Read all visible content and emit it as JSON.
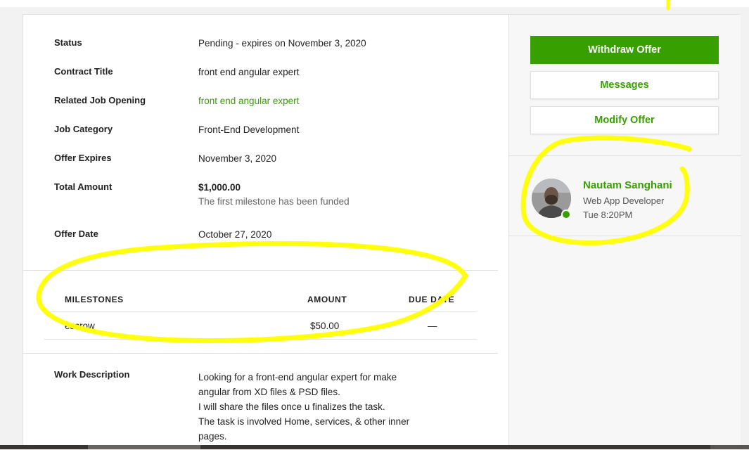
{
  "details": [
    {
      "label": "Status",
      "value": "Pending - expires on November 3, 2020"
    },
    {
      "label": "Contract Title",
      "value": "front end angular expert"
    },
    {
      "label": "Related Job Opening",
      "value": "front end angular expert"
    },
    {
      "label": "Job Category",
      "value": "Front-End Development"
    },
    {
      "label": "Offer Expires",
      "value": "November 3, 2020"
    },
    {
      "label": "Total Amount",
      "value": "$1,000.00",
      "note": "The first milestone has been funded"
    },
    {
      "label": "Offer Date",
      "value": "October 27, 2020"
    }
  ],
  "milestones": {
    "headers": {
      "name": "MILESTONES",
      "amount": "AMOUNT",
      "due": "DUE DATE"
    },
    "rows": [
      {
        "name": "escrow",
        "amount": "$50.00",
        "due": "—"
      }
    ]
  },
  "work_description": {
    "label": "Work Description",
    "lines": [
      "Looking for a front-end angular expert for make",
      "angular from XD files & PSD files.",
      "I will share the files once u finalizes the task.",
      "The task is involved Home, services, & other inner",
      "pages."
    ]
  },
  "actions": {
    "withdraw": "Withdraw Offer",
    "messages": "Messages",
    "modify": "Modify Offer"
  },
  "freelancer": {
    "name": "Nautam Sanghani",
    "title": "Web App Developer",
    "local_time": "Tue 8:20PM",
    "status": "online"
  },
  "colors": {
    "brand_green": "#37a000",
    "highlight": "#ffff00"
  }
}
